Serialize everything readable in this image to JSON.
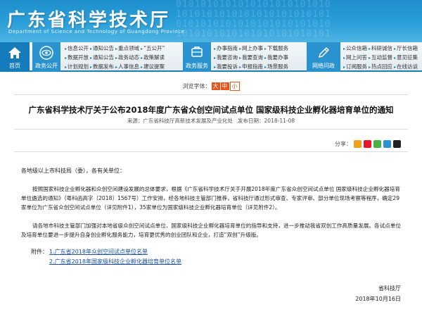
{
  "header": {
    "title": "广东省科学技术厅",
    "subtitle": "Department of Science and Technology of Guangdong Province",
    "binary_pattern": "0101010101010101010101010\n1010101010101010101010101\n0101010101010101010101010\n1010101010101010101010101"
  },
  "nav": {
    "home": "首页",
    "gov_public": "政务公开",
    "gov_public_links": [
      [
        "信息公开",
        "通知公告",
        "重点领域",
        "“五公开”"
      ],
      [
        "数据开放",
        "通知公告",
        "政务动态",
        "政策解读"
      ],
      [
        "计划规划",
        "数据发布",
        "人事信息",
        "建议提案"
      ]
    ],
    "gov_service": "政务服务",
    "gov_service_links": [
      [
        "办事指南",
        "网上办事",
        "下载服务"
      ],
      [
        "我要咨询",
        "我要查询",
        "我要办事"
      ],
      [
        "我要投诉",
        "申报指南",
        "场景服务"
      ]
    ],
    "interaction": "网络问政",
    "interaction_links": [
      [
        "公众信箱",
        "科研诚信",
        "厅长信箱"
      ],
      [
        "网上问答",
        "互动监督",
        "意见征集"
      ],
      [
        "订阅服务",
        "热点回应",
        "在线访谈"
      ]
    ]
  },
  "font_size": {
    "label": "浏览字体：",
    "large": "大",
    "medium": "中",
    "small": "小"
  },
  "article": {
    "title": "广东省科学技术厅关于公布2018年度广东省众创空间试点单位 国家级科技企业孵化器培育单位的通知",
    "source_label": "来源：",
    "source": "广东省科技厅高新技术发展及产业化处",
    "date_label": "发布日期：",
    "date": "2018-11-08",
    "share_label": "分享：",
    "salutation": "各地级以上市科技局（委），各有关单位：",
    "para1": "按照国家科技企业孵化器和众创空间建设发展的总体要求，根据《广东省科学技术厅关于开展2018年度广东省众创空间试点单位 国家级科技企业孵化器培育单位遴选的通知》（粤科函高字〔2018〕1567号）工作安排，经各地科技主管部门推荐，省科技厅通过形式审查、专家评审、部分单位现场考察等程序，确定29家单位为广东省众创空间试点单位（详见附件1），35家单位为国家级科技企业孵化器培育单位（详见附件2）。",
    "para2": "请各地市科技主管部门加强对本地省级众创空间试点单位、国家级科技企业孵化器培育单位的指导和支持，进一步推动我省双创工作高质量发展。各试点单位及培育单位要进一步提升自身创业孵化服务能力，培育更优秀的创业团队和企业，打造“双创”升级版。",
    "attachments_label": "附件：",
    "attachments": [
      "1.广东省2018年众创空间试点单位名单",
      "2.广东省2018年国家级科技企业孵化器培育单位名单"
    ],
    "signature": "省科技厅",
    "sign_date": "2018年10月16日"
  },
  "colors": {
    "banner": "#2b9fd9",
    "nav_block": "#2a93cf",
    "accent": "#e8541a",
    "link": "#1a4fa0"
  }
}
